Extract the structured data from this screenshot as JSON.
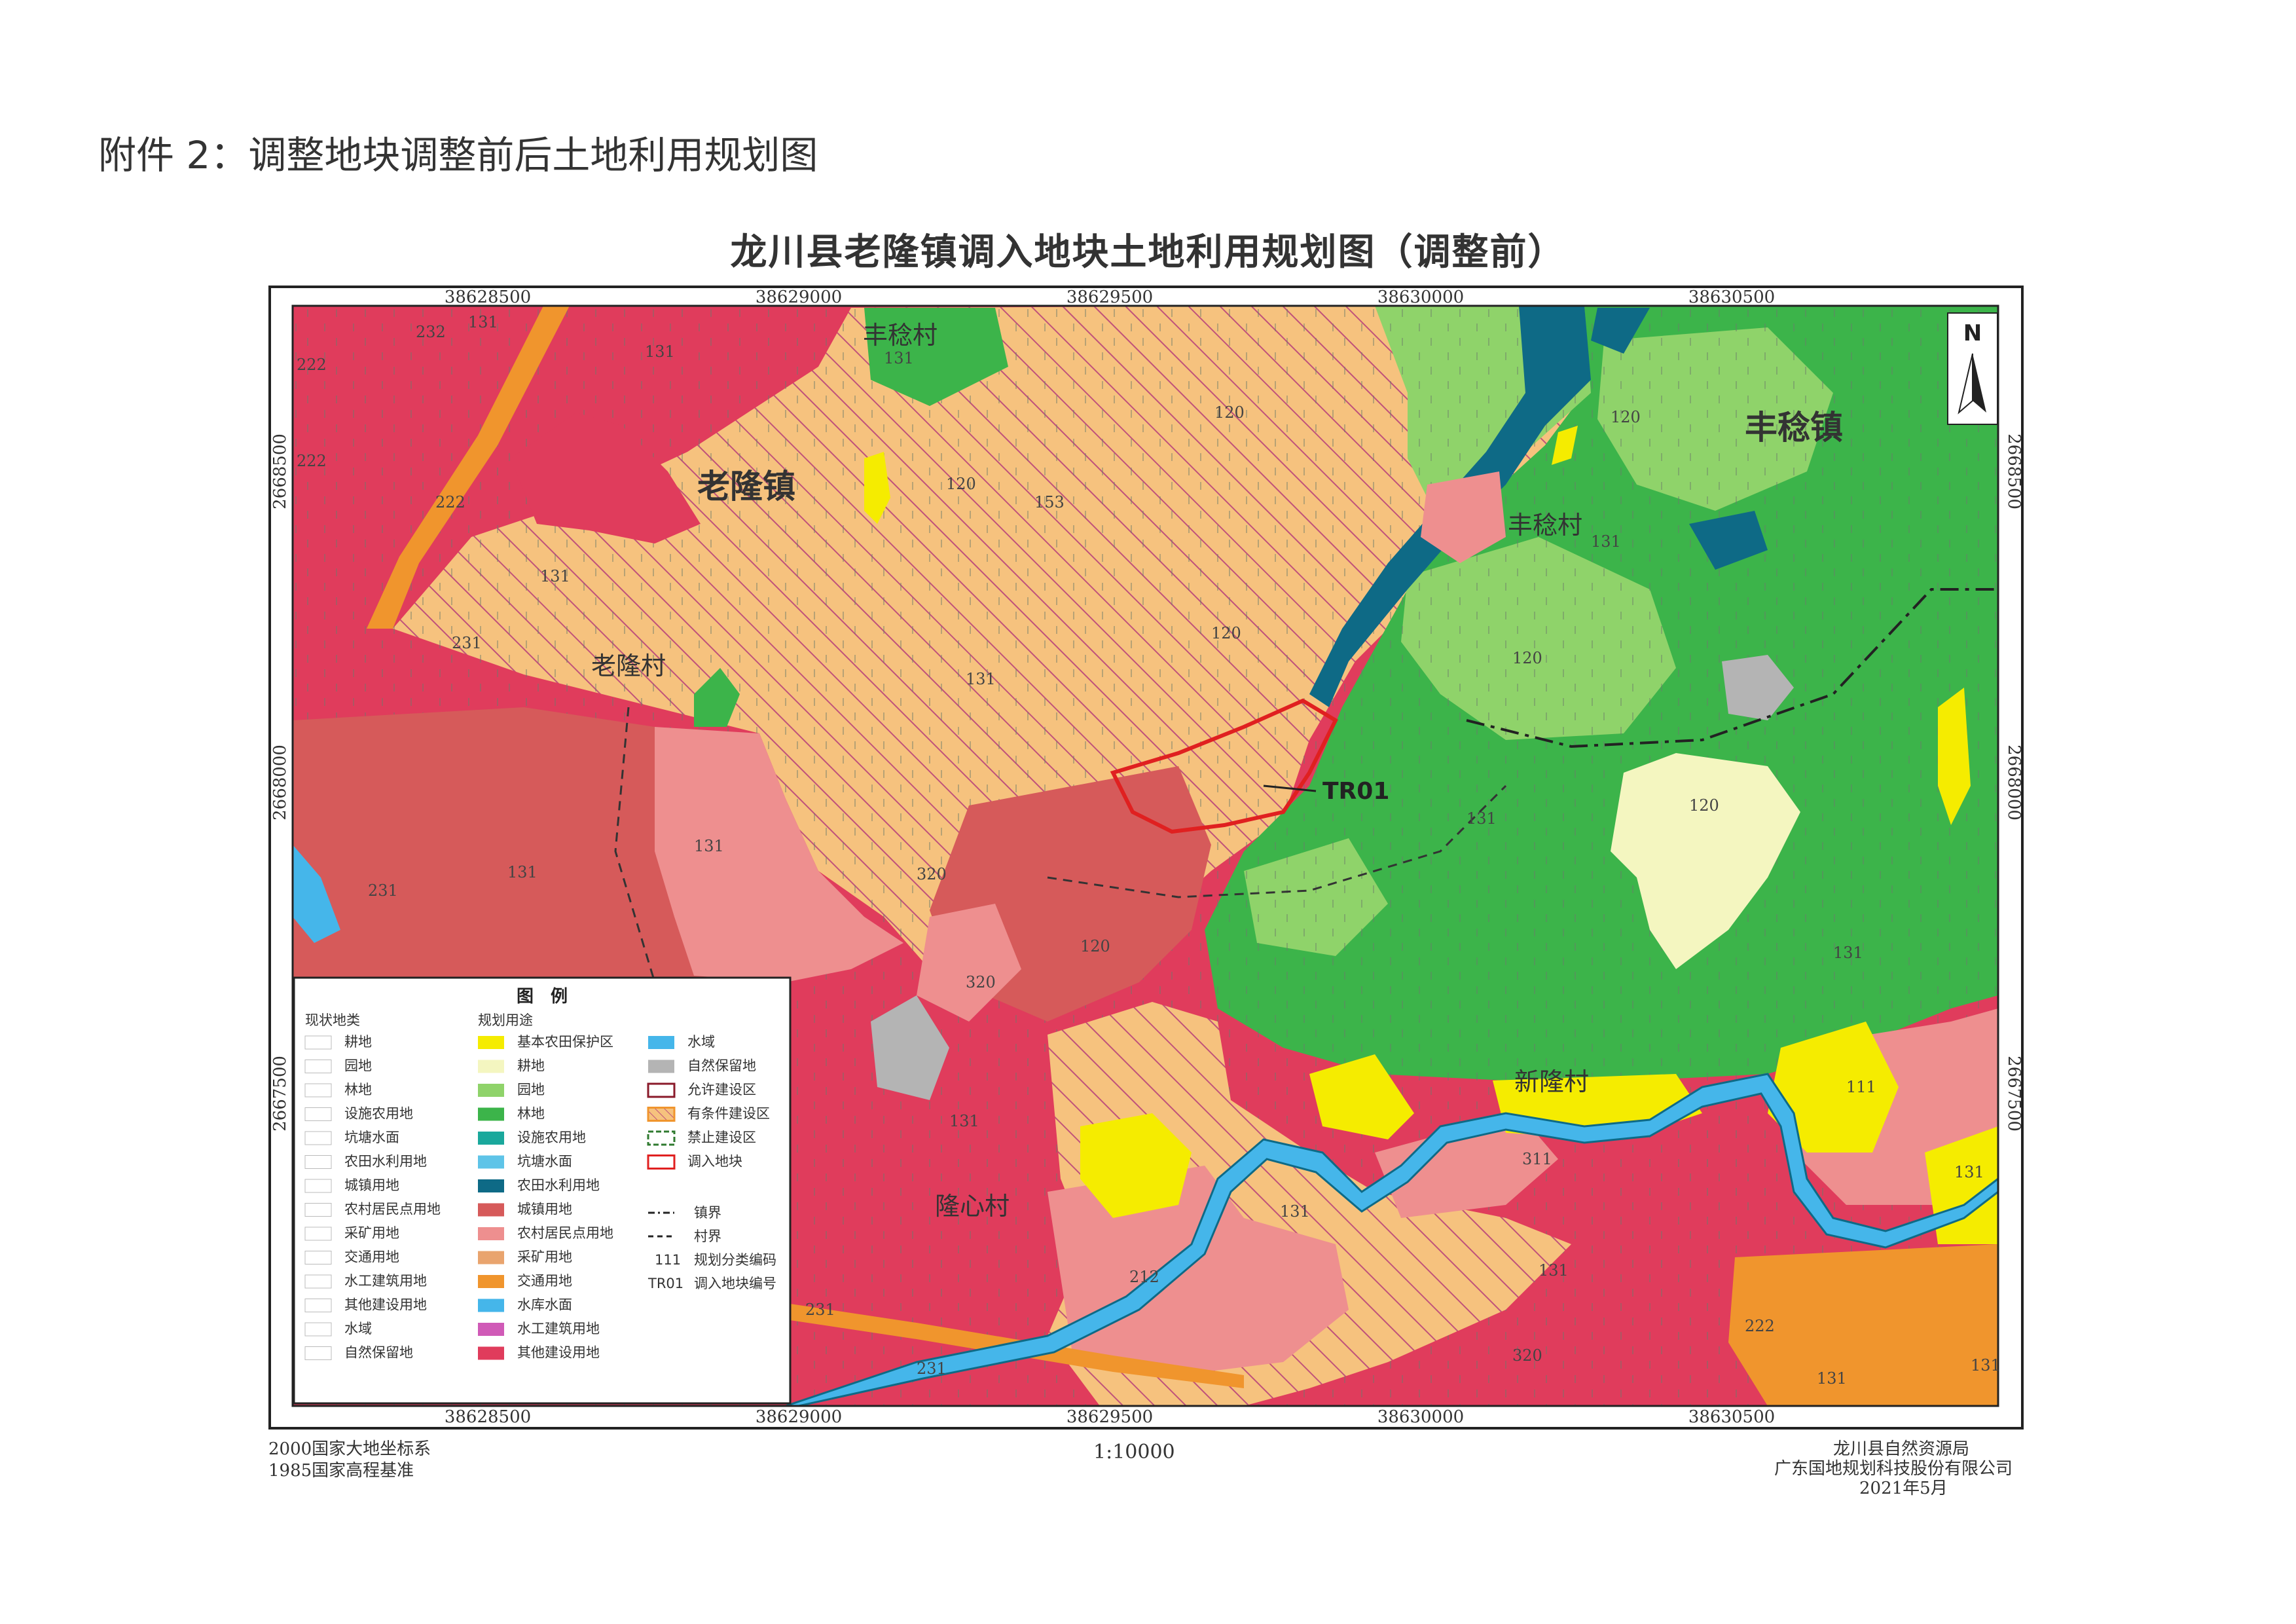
{
  "attachment_title": "附件 2：调整地块调整前后土地利用规划图",
  "map": {
    "title": "龙川县老隆镇调入地块土地利用规划图（调整前）",
    "north_label": "N",
    "coords_x": [
      "38628500",
      "38629000",
      "38629500",
      "38630000",
      "38630500"
    ],
    "coords_y": [
      "2668500",
      "2668000",
      "2667500"
    ],
    "place_names": {
      "laolong_town": "老隆镇",
      "fengwen_town": "丰稔镇",
      "laolong_village": "老隆村",
      "fengwen_village_top": "丰稔村",
      "fengwen_village_mid": "丰稔村",
      "longxin_village": "隆心村",
      "xinlong_village": "新隆村"
    },
    "parcel_label": "TR01",
    "codes": [
      "232",
      "131",
      "131",
      "131",
      "222",
      "222",
      "222",
      "131",
      "120",
      "153",
      "120",
      "131",
      "120",
      "131",
      "120",
      "120",
      "131",
      "231",
      "131",
      "131",
      "231",
      "320",
      "320",
      "120",
      "131",
      "120",
      "131",
      "111",
      "311",
      "131",
      "131",
      "131",
      "212",
      "231",
      "231",
      "320",
      "222",
      "131",
      "131"
    ]
  },
  "legend": {
    "title": "图　例",
    "status_header": "现状地类",
    "planning_header": "规划用途",
    "status_items": [
      "耕地",
      "园地",
      "林地",
      "设施农用地",
      "坑塘水面",
      "农田水利用地",
      "城镇用地",
      "农村居民点用地",
      "采矿用地",
      "交通用地",
      "水工建筑用地",
      "其他建设用地",
      "水域",
      "自然保留地"
    ],
    "planning_items": [
      {
        "label": "基本农田保护区",
        "color": "#f5ec00"
      },
      {
        "label": "耕地",
        "color": "#f4f6c0"
      },
      {
        "label": "园地",
        "color": "#8fd36a"
      },
      {
        "label": "林地",
        "color": "#3cb44a"
      },
      {
        "label": "设施农用地",
        "color": "#1aa89c"
      },
      {
        "label": "坑塘水面",
        "color": "#5ec4e8"
      },
      {
        "label": "农田水利用地",
        "color": "#0e6a86"
      },
      {
        "label": "城镇用地",
        "color": "#d65a5a"
      },
      {
        "label": "农村居民点用地",
        "color": "#ee8f8f"
      },
      {
        "label": "采矿用地",
        "color": "#e9a46e"
      },
      {
        "label": "交通用地",
        "color": "#f0952d"
      },
      {
        "label": "水库水面",
        "color": "#45b6ea"
      },
      {
        "label": "水工建筑用地",
        "color": "#d05ab7"
      },
      {
        "label": "其他建设用地",
        "color": "#e03c5c"
      }
    ],
    "zone_items": [
      {
        "label": "水域",
        "color": "#45b6ea"
      },
      {
        "label": "自然保留地",
        "color": "#b4b4b4"
      },
      {
        "label": "允许建设区",
        "color": "#8a1a2a"
      },
      {
        "label": "有条件建设区",
        "color": "#f0952d"
      },
      {
        "label": "禁止建设区",
        "color": "#2f7a2f"
      },
      {
        "label": "调入地块",
        "color": "#e02020"
      }
    ],
    "line_items": [
      "镇界",
      "村界"
    ],
    "code_example": "111",
    "code_desc": "规划分类编码",
    "parcel_example": "TR01",
    "parcel_desc": "调入地块编号"
  },
  "footer": {
    "coord_system": "2000国家大地坐标系",
    "height_datum": "1985国家高程基准",
    "scale": "1:10000",
    "org1": "龙川县自然资源局",
    "org2": "广东国地规划科技股份有限公司",
    "date": "2021年5月"
  },
  "colors": {
    "town_red": "#e03c5c",
    "urban": "#d65a5a",
    "rural": "#ee8f8f",
    "orange_zone": "#f6c27e",
    "hatch": "#c0527a",
    "forest": "#3cb44a",
    "garden": "#8fd36a",
    "farmland": "#f5ec00",
    "water": "#45b6ea",
    "irrigation": "#0e6a86",
    "transport": "#f0952d",
    "reserve": "#b4b4b4",
    "parcel_outline": "#e02020"
  }
}
